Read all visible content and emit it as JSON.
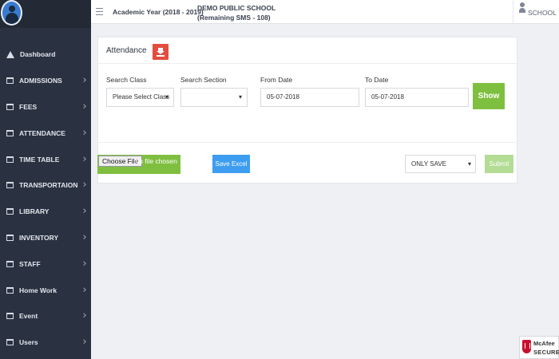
{
  "topbar": {
    "academic_year": "Academic Year (2018 - 2019)",
    "school_name": "DEMO PUBLIC SCHOOL",
    "sms_remaining": "(Remaining SMS - 108)",
    "user_label": "SCHOOL"
  },
  "sidebar": {
    "items": [
      {
        "label": "Dashboard",
        "icon": "home-icon",
        "has_submenu": false
      },
      {
        "label": "ADMISSIONS",
        "icon": "briefcase-icon",
        "has_submenu": true
      },
      {
        "label": "FEES",
        "icon": "briefcase-icon",
        "has_submenu": true
      },
      {
        "label": "ATTENDANCE",
        "icon": "briefcase-icon",
        "has_submenu": true
      },
      {
        "label": "TIME TABLE",
        "icon": "briefcase-icon",
        "has_submenu": true
      },
      {
        "label": "TRANSPORTAION",
        "icon": "briefcase-icon",
        "has_submenu": true
      },
      {
        "label": "LIBRARY",
        "icon": "briefcase-icon",
        "has_submenu": true
      },
      {
        "label": "INVENTORY",
        "icon": "briefcase-icon",
        "has_submenu": true
      },
      {
        "label": "STAFF",
        "icon": "briefcase-icon",
        "has_submenu": true
      },
      {
        "label": "Home Work",
        "icon": "briefcase-icon",
        "has_submenu": true
      },
      {
        "label": "Event",
        "icon": "briefcase-icon",
        "has_submenu": true
      },
      {
        "label": "Users",
        "icon": "briefcase-icon",
        "has_submenu": true
      }
    ]
  },
  "panel": {
    "title": "Attendance",
    "search_class": {
      "label": "Search Class",
      "value": "Please Select Class"
    },
    "search_section": {
      "label": "Search Section",
      "value": ""
    },
    "from_date": {
      "label": "From Date",
      "value": "05-07-2018"
    },
    "to_date": {
      "label": "To Date",
      "value": "05-07-2018"
    },
    "show_label": "Show",
    "file_button": "Choose File",
    "file_status": "No file chosen",
    "save_excel_label": "Save Excel",
    "save_mode": "ONLY SAVE",
    "submit_label": "Submit"
  },
  "badge": {
    "name": "McAfee",
    "subtitle": "SECURE"
  },
  "colors": {
    "sidebar_bg": "#2a3140",
    "show_button": "#7fbf3f",
    "download_button": "#e24d3f",
    "excel_button": "#3d9df0",
    "submit_button": "#b4dc95"
  }
}
